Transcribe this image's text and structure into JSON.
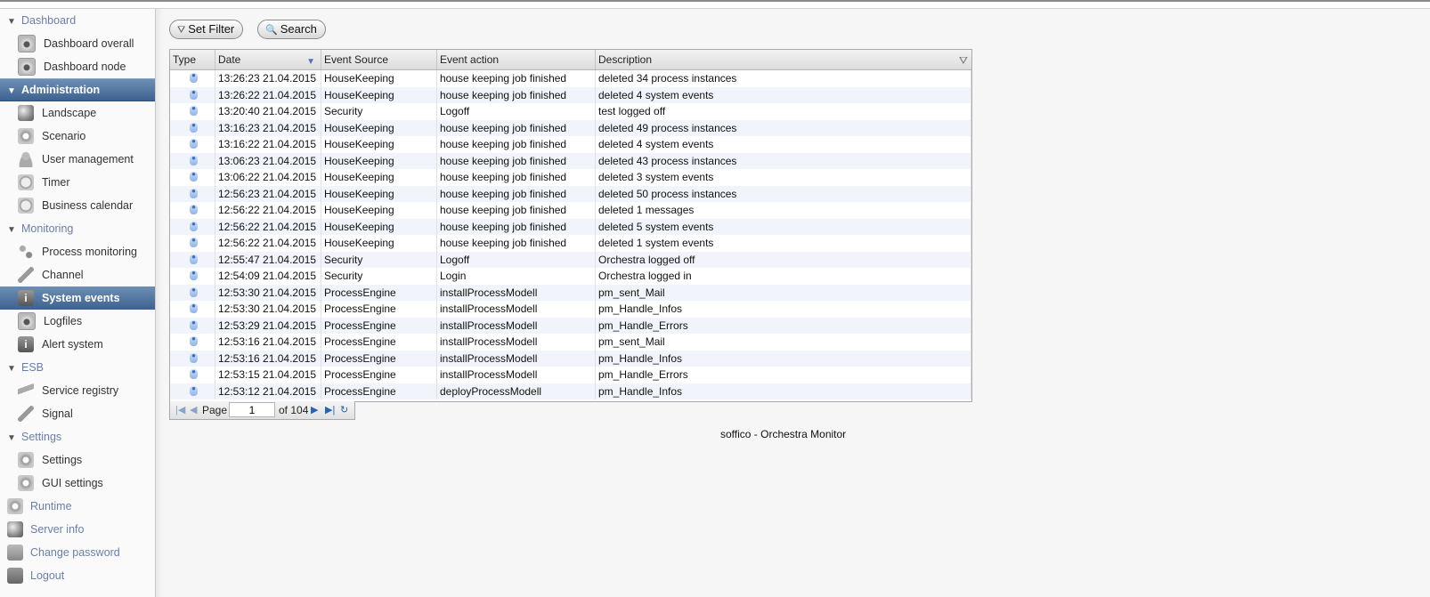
{
  "sidebar": {
    "dashboard": {
      "label": "Dashboard",
      "items": [
        {
          "label": "Dashboard overall",
          "icon": "disk-icon"
        },
        {
          "label": "Dashboard node",
          "icon": "disk-icon"
        }
      ]
    },
    "administration": {
      "label": "Administration",
      "items": [
        {
          "label": "Landscape",
          "icon": "globe-icon"
        },
        {
          "label": "Scenario",
          "icon": "gear-icon"
        },
        {
          "label": "User management",
          "icon": "user-icon"
        },
        {
          "label": "Timer",
          "icon": "clock-icon"
        },
        {
          "label": "Business calendar",
          "icon": "calendar-clock-icon"
        }
      ]
    },
    "monitoring": {
      "label": "Monitoring",
      "items": [
        {
          "label": "Process monitoring",
          "icon": "flow-icon"
        },
        {
          "label": "Channel",
          "icon": "pen-icon"
        },
        {
          "label": "System events",
          "icon": "info-icon"
        },
        {
          "label": "Logfiles",
          "icon": "disk-icon"
        },
        {
          "label": "Alert system",
          "icon": "info-icon"
        }
      ]
    },
    "esb": {
      "label": "ESB",
      "items": [
        {
          "label": "Service registry",
          "icon": "leaf-icon"
        },
        {
          "label": "Signal",
          "icon": "pen-icon"
        }
      ]
    },
    "settings": {
      "label": "Settings",
      "items": [
        {
          "label": "Settings",
          "icon": "gear-icon"
        },
        {
          "label": "GUI settings",
          "icon": "gear-icon"
        }
      ]
    },
    "runtime": {
      "label": "Runtime"
    },
    "server_info": {
      "label": "Server info"
    },
    "change_password": {
      "label": "Change password"
    },
    "logout": {
      "label": "Logout"
    }
  },
  "toolbar": {
    "set_filter_label": "Set Filter",
    "search_label": "Search"
  },
  "grid": {
    "columns": [
      "Type",
      "Date",
      "Event Source",
      "Event action",
      "Description"
    ],
    "rows": [
      [
        "13:26:23 21.04.2015",
        "HouseKeeping",
        "house keeping job finished",
        "deleted 34 process instances"
      ],
      [
        "13:26:22 21.04.2015",
        "HouseKeeping",
        "house keeping job finished",
        "deleted 4 system events"
      ],
      [
        "13:20:40 21.04.2015",
        "Security",
        "Logoff",
        "test logged off"
      ],
      [
        "13:16:23 21.04.2015",
        "HouseKeeping",
        "house keeping job finished",
        "deleted 49 process instances"
      ],
      [
        "13:16:22 21.04.2015",
        "HouseKeeping",
        "house keeping job finished",
        "deleted 4 system events"
      ],
      [
        "13:06:23 21.04.2015",
        "HouseKeeping",
        "house keeping job finished",
        "deleted 43 process instances"
      ],
      [
        "13:06:22 21.04.2015",
        "HouseKeeping",
        "house keeping job finished",
        "deleted 3 system events"
      ],
      [
        "12:56:23 21.04.2015",
        "HouseKeeping",
        "house keeping job finished",
        "deleted 50 process instances"
      ],
      [
        "12:56:22 21.04.2015",
        "HouseKeeping",
        "house keeping job finished",
        "deleted 1 messages"
      ],
      [
        "12:56:22 21.04.2015",
        "HouseKeeping",
        "house keeping job finished",
        "deleted 5 system events"
      ],
      [
        "12:56:22 21.04.2015",
        "HouseKeeping",
        "house keeping job finished",
        "deleted 1 system events"
      ],
      [
        "12:55:47 21.04.2015",
        "Security",
        "Logoff",
        "Orchestra logged off"
      ],
      [
        "12:54:09 21.04.2015",
        "Security",
        "Login",
        "Orchestra logged in"
      ],
      [
        "12:53:30 21.04.2015",
        "ProcessEngine",
        "installProcessModell",
        "pm_sent_Mail"
      ],
      [
        "12:53:30 21.04.2015",
        "ProcessEngine",
        "installProcessModell",
        "pm_Handle_Infos"
      ],
      [
        "12:53:29 21.04.2015",
        "ProcessEngine",
        "installProcessModell",
        "pm_Handle_Errors"
      ],
      [
        "12:53:16 21.04.2015",
        "ProcessEngine",
        "installProcessModell",
        "pm_sent_Mail"
      ],
      [
        "12:53:16 21.04.2015",
        "ProcessEngine",
        "installProcessModell",
        "pm_Handle_Infos"
      ],
      [
        "12:53:15 21.04.2015",
        "ProcessEngine",
        "installProcessModell",
        "pm_Handle_Errors"
      ],
      [
        "12:53:12 21.04.2015",
        "ProcessEngine",
        "deployProcessModell",
        "pm_Handle_Infos"
      ]
    ]
  },
  "pager": {
    "page_label": "Page",
    "page_value": "1",
    "of_label": "of 104"
  },
  "footer": "soffico - Orchestra Monitor"
}
